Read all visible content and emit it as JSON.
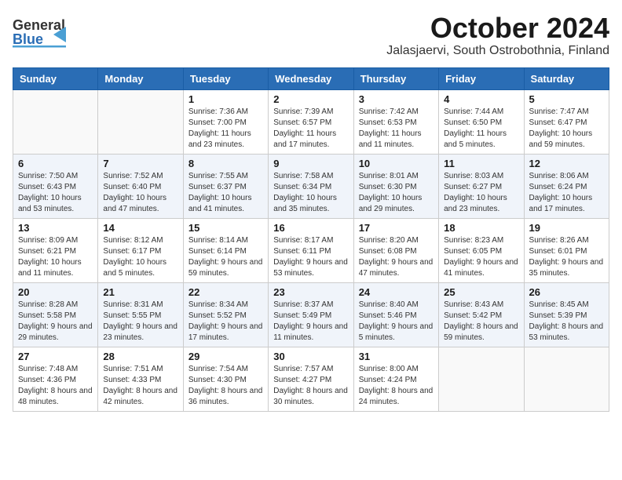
{
  "header": {
    "logo_general": "General",
    "logo_blue": "Blue",
    "title": "October 2024",
    "subtitle": "Jalasjaervi, South Ostrobothnia, Finland"
  },
  "weekdays": [
    "Sunday",
    "Monday",
    "Tuesday",
    "Wednesday",
    "Thursday",
    "Friday",
    "Saturday"
  ],
  "weeks": [
    [
      {
        "day": "",
        "info": ""
      },
      {
        "day": "",
        "info": ""
      },
      {
        "day": "1",
        "info": "Sunrise: 7:36 AM\nSunset: 7:00 PM\nDaylight: 11 hours\nand 23 minutes."
      },
      {
        "day": "2",
        "info": "Sunrise: 7:39 AM\nSunset: 6:57 PM\nDaylight: 11 hours\nand 17 minutes."
      },
      {
        "day": "3",
        "info": "Sunrise: 7:42 AM\nSunset: 6:53 PM\nDaylight: 11 hours\nand 11 minutes."
      },
      {
        "day": "4",
        "info": "Sunrise: 7:44 AM\nSunset: 6:50 PM\nDaylight: 11 hours\nand 5 minutes."
      },
      {
        "day": "5",
        "info": "Sunrise: 7:47 AM\nSunset: 6:47 PM\nDaylight: 10 hours\nand 59 minutes."
      }
    ],
    [
      {
        "day": "6",
        "info": "Sunrise: 7:50 AM\nSunset: 6:43 PM\nDaylight: 10 hours\nand 53 minutes."
      },
      {
        "day": "7",
        "info": "Sunrise: 7:52 AM\nSunset: 6:40 PM\nDaylight: 10 hours\nand 47 minutes."
      },
      {
        "day": "8",
        "info": "Sunrise: 7:55 AM\nSunset: 6:37 PM\nDaylight: 10 hours\nand 41 minutes."
      },
      {
        "day": "9",
        "info": "Sunrise: 7:58 AM\nSunset: 6:34 PM\nDaylight: 10 hours\nand 35 minutes."
      },
      {
        "day": "10",
        "info": "Sunrise: 8:01 AM\nSunset: 6:30 PM\nDaylight: 10 hours\nand 29 minutes."
      },
      {
        "day": "11",
        "info": "Sunrise: 8:03 AM\nSunset: 6:27 PM\nDaylight: 10 hours\nand 23 minutes."
      },
      {
        "day": "12",
        "info": "Sunrise: 8:06 AM\nSunset: 6:24 PM\nDaylight: 10 hours\nand 17 minutes."
      }
    ],
    [
      {
        "day": "13",
        "info": "Sunrise: 8:09 AM\nSunset: 6:21 PM\nDaylight: 10 hours\nand 11 minutes."
      },
      {
        "day": "14",
        "info": "Sunrise: 8:12 AM\nSunset: 6:17 PM\nDaylight: 10 hours\nand 5 minutes."
      },
      {
        "day": "15",
        "info": "Sunrise: 8:14 AM\nSunset: 6:14 PM\nDaylight: 9 hours\nand 59 minutes."
      },
      {
        "day": "16",
        "info": "Sunrise: 8:17 AM\nSunset: 6:11 PM\nDaylight: 9 hours\nand 53 minutes."
      },
      {
        "day": "17",
        "info": "Sunrise: 8:20 AM\nSunset: 6:08 PM\nDaylight: 9 hours\nand 47 minutes."
      },
      {
        "day": "18",
        "info": "Sunrise: 8:23 AM\nSunset: 6:05 PM\nDaylight: 9 hours\nand 41 minutes."
      },
      {
        "day": "19",
        "info": "Sunrise: 8:26 AM\nSunset: 6:01 PM\nDaylight: 9 hours\nand 35 minutes."
      }
    ],
    [
      {
        "day": "20",
        "info": "Sunrise: 8:28 AM\nSunset: 5:58 PM\nDaylight: 9 hours\nand 29 minutes."
      },
      {
        "day": "21",
        "info": "Sunrise: 8:31 AM\nSunset: 5:55 PM\nDaylight: 9 hours\nand 23 minutes."
      },
      {
        "day": "22",
        "info": "Sunrise: 8:34 AM\nSunset: 5:52 PM\nDaylight: 9 hours\nand 17 minutes."
      },
      {
        "day": "23",
        "info": "Sunrise: 8:37 AM\nSunset: 5:49 PM\nDaylight: 9 hours\nand 11 minutes."
      },
      {
        "day": "24",
        "info": "Sunrise: 8:40 AM\nSunset: 5:46 PM\nDaylight: 9 hours\nand 5 minutes."
      },
      {
        "day": "25",
        "info": "Sunrise: 8:43 AM\nSunset: 5:42 PM\nDaylight: 8 hours\nand 59 minutes."
      },
      {
        "day": "26",
        "info": "Sunrise: 8:45 AM\nSunset: 5:39 PM\nDaylight: 8 hours\nand 53 minutes."
      }
    ],
    [
      {
        "day": "27",
        "info": "Sunrise: 7:48 AM\nSunset: 4:36 PM\nDaylight: 8 hours\nand 48 minutes."
      },
      {
        "day": "28",
        "info": "Sunrise: 7:51 AM\nSunset: 4:33 PM\nDaylight: 8 hours\nand 42 minutes."
      },
      {
        "day": "29",
        "info": "Sunrise: 7:54 AM\nSunset: 4:30 PM\nDaylight: 8 hours\nand 36 minutes."
      },
      {
        "day": "30",
        "info": "Sunrise: 7:57 AM\nSunset: 4:27 PM\nDaylight: 8 hours\nand 30 minutes."
      },
      {
        "day": "31",
        "info": "Sunrise: 8:00 AM\nSunset: 4:24 PM\nDaylight: 8 hours\nand 24 minutes."
      },
      {
        "day": "",
        "info": ""
      },
      {
        "day": "",
        "info": ""
      }
    ]
  ]
}
